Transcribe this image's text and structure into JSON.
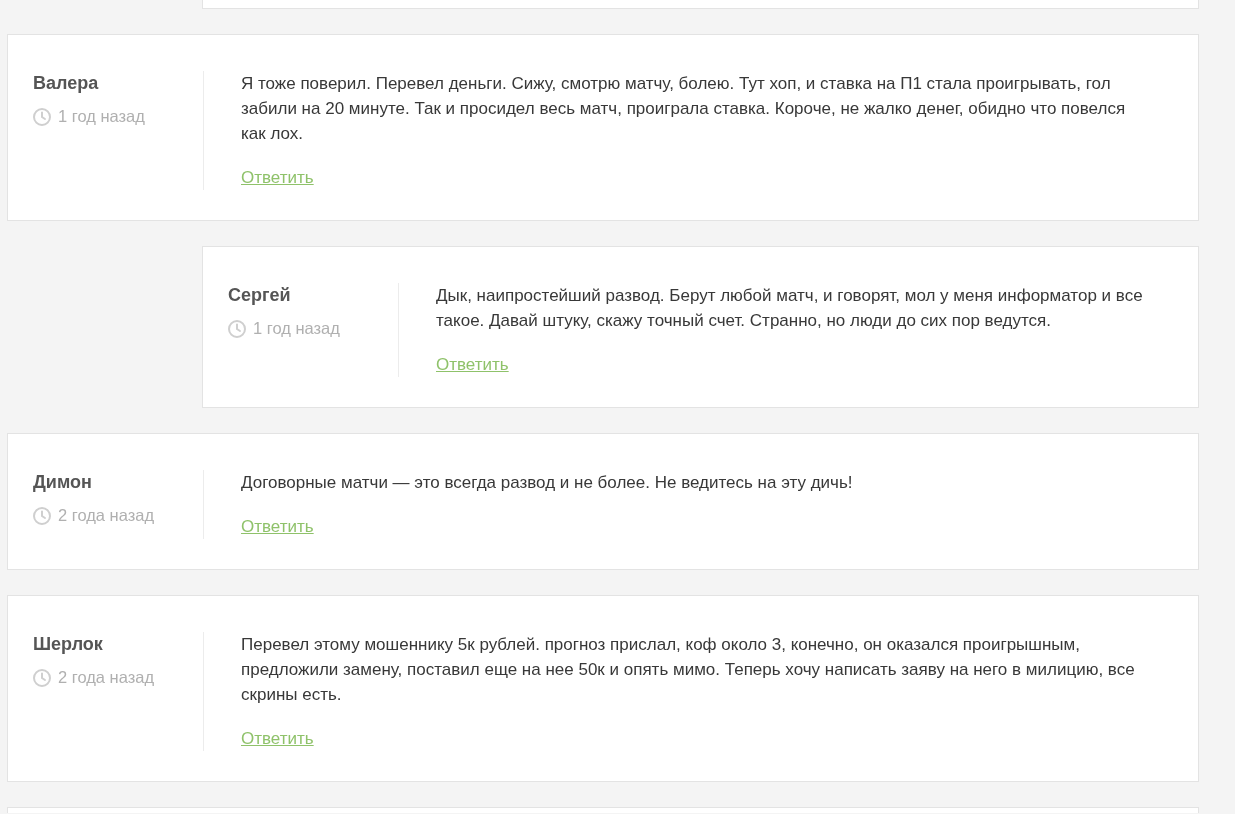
{
  "comments": [
    {
      "author": "Валера",
      "time": "1 год назад",
      "text": "Я тоже поверил. Перевел деньги. Сижу, смотрю матчу, болею. Тут хоп, и ставка на П1 стала проигрывать, гол забили на 20 минуте. Так и просидел весь матч, проиграла ставка. Короче, не жалко денег, обидно что повелся как лох.",
      "reply_link": "Ответить",
      "children": [
        {
          "author": "Сергей",
          "time": "1 год назад",
          "text": "Дык, наипростейший развод. Берут любой матч, и говорят, мол у меня информатор и все такое. Давай штуку, скажу точный счет. Странно, но люди до сих пор ведутся.",
          "reply_link": "Ответить"
        }
      ]
    },
    {
      "author": "Димон",
      "time": "2 года назад",
      "text": "Договорные матчи — это всегда развод и не более. Не ведитесь на эту дичь!",
      "reply_link": "Ответить"
    },
    {
      "author": "Шерлок",
      "time": "2 года назад",
      "text": "Перевел этому мошеннику 5к рублей. прогноз прислал, коф около 3, конечно, он оказался проигрышным, предложили замену, поставил еще на нее 50к и опять мимо. Теперь хочу написать заяву на него в милицию, все скрины есть.",
      "reply_link": "Ответить"
    }
  ]
}
